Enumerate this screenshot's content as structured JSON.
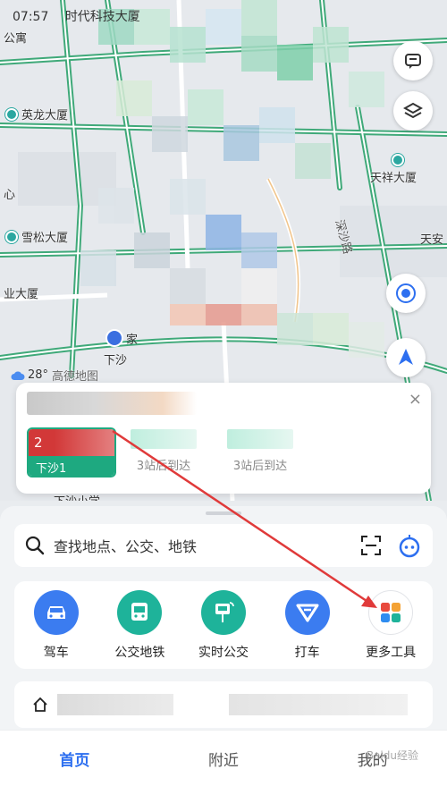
{
  "status_bar": {
    "time": "07:57",
    "label": "时代科技大厦"
  },
  "map": {
    "pois": [
      {
        "id": "yinglong",
        "label": "英龙大厦"
      },
      {
        "id": "xuesong",
        "label": "雪松大厦"
      },
      {
        "id": "tianxiang",
        "label": "天祥大厦"
      }
    ],
    "labels": {
      "gongyu": "公寓",
      "xin": "心",
      "ye_dasha": "业大厦",
      "tian_an": "天安",
      "xiasha": "下沙",
      "home": "家",
      "xiasha_xiaoxue": "下沙小学",
      "shensha_road": "深沙路"
    },
    "weather": {
      "temp": "28°",
      "brand": "高德地图"
    }
  },
  "bus_card": {
    "stop_name": "下沙1",
    "stop_number": "2",
    "etas": [
      "3站后到达",
      "3站后到达"
    ],
    "close": "×"
  },
  "search": {
    "placeholder": "查找地点、公交、地铁"
  },
  "tools": [
    {
      "id": "drive",
      "label": "驾车",
      "color": "#3b7cf0"
    },
    {
      "id": "transit",
      "label": "公交地铁",
      "color": "#1eb39a"
    },
    {
      "id": "realtime-bus",
      "label": "实时公交",
      "color": "#1eb39a"
    },
    {
      "id": "taxi",
      "label": "打车",
      "color": "#3b7cf0"
    },
    {
      "id": "more-tools",
      "label": "更多工具",
      "color": "#ffffff"
    }
  ],
  "tabs": [
    {
      "id": "home",
      "label": "首页",
      "active": true
    },
    {
      "id": "nearby",
      "label": "附近",
      "active": false
    },
    {
      "id": "mine",
      "label": "我的",
      "active": false
    }
  ],
  "watermark": "Baidu经验",
  "colors": {
    "accent": "#2d6ff0",
    "road": "#2ea36d",
    "annotation": "#e03a3a"
  }
}
